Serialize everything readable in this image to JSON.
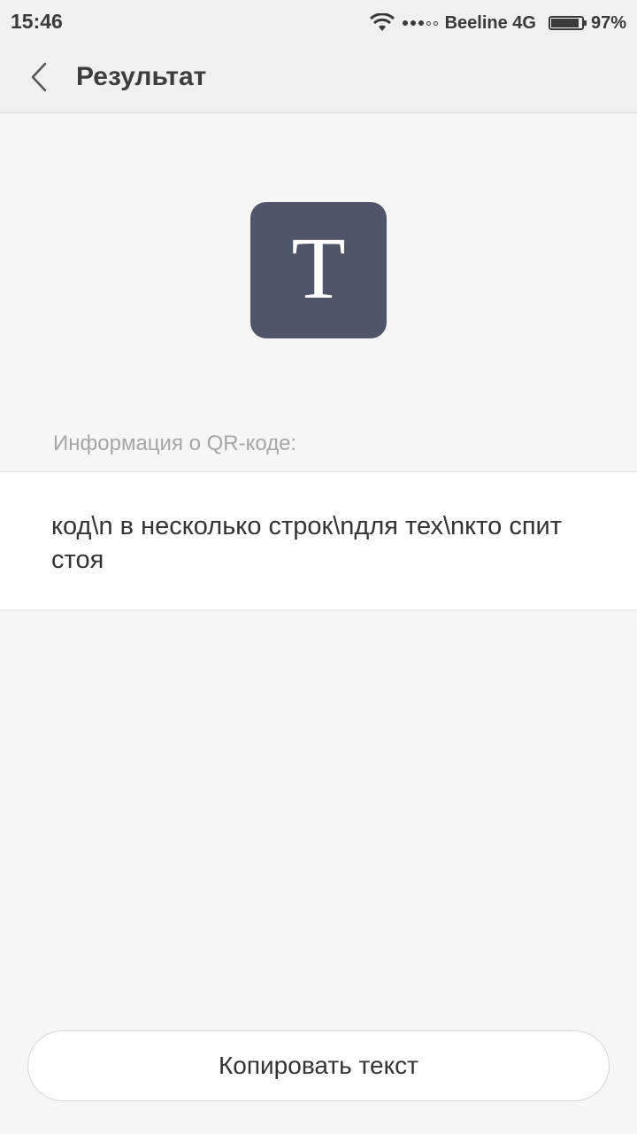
{
  "status_bar": {
    "time": "15:46",
    "carrier": "Beeline 4G",
    "battery_percent": "97%",
    "battery_level": 0.97,
    "signal_bars": 3,
    "signal_total": 5
  },
  "header": {
    "title": "Результат"
  },
  "result": {
    "icon_letter": "T",
    "icon_color": "#4f566a",
    "section_label": "Информация о QR-коде:",
    "content": "код\\n в несколько строк\\nдля тех\\nкто спит стоя"
  },
  "actions": {
    "copy_label": "Копировать текст"
  }
}
